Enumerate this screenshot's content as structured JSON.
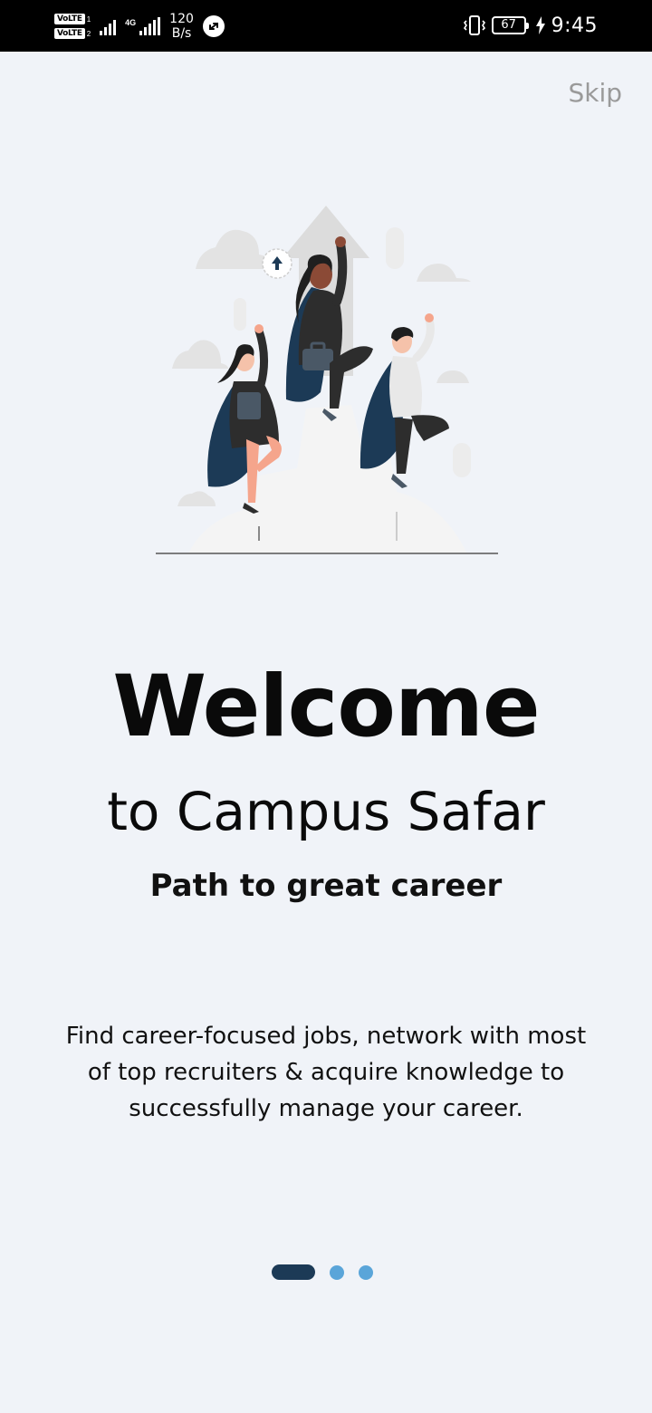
{
  "status_bar": {
    "volte1": "VoLTE",
    "volte1_sim": "1",
    "volte2": "VoLTE",
    "volte2_sim": "2",
    "network_type": "4G",
    "speed_value": "120",
    "speed_unit": "B/s",
    "battery_level": "67",
    "time": "9:45"
  },
  "header": {
    "skip_label": "Skip"
  },
  "onboarding": {
    "title": "Welcome",
    "subtitle": "to Campus Safar",
    "tagline": "Path to great career",
    "description": "Find career-focused jobs, network with most of top recruiters & acquire knowledge to successfully manage your career."
  },
  "pager": {
    "total_pages": 3,
    "current_page": 1
  },
  "colors": {
    "background": "#f0f3f8",
    "primary_dark": "#1c3a56",
    "accent_blue": "#5aa5d9",
    "skip_gray": "#9a9a9a"
  }
}
